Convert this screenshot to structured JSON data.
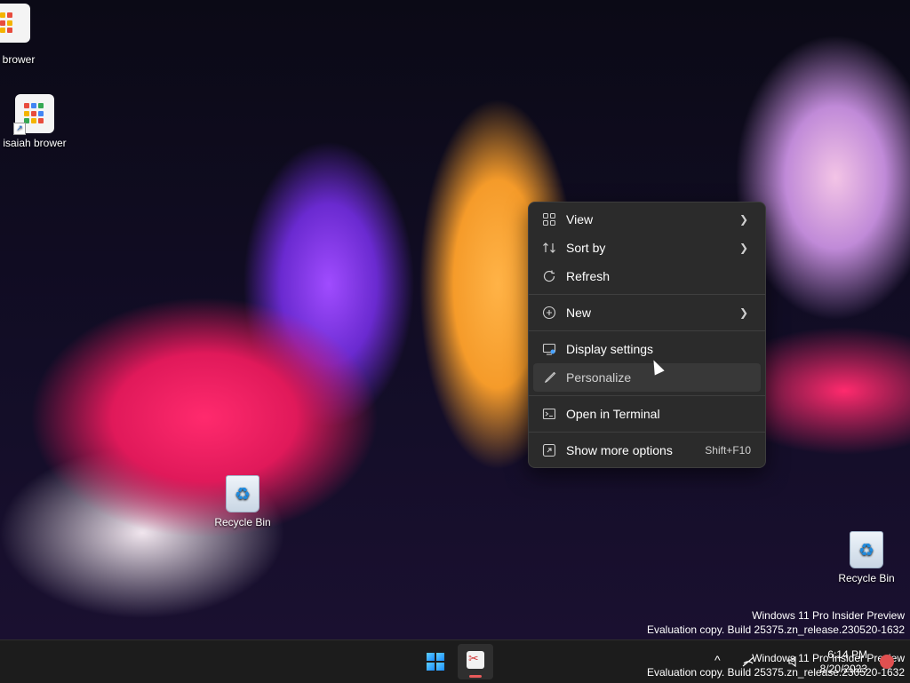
{
  "desktop": {
    "icons": [
      {
        "label": "isaiah brower",
        "kind": "app-shortcut"
      },
      {
        "label": "isaiah brower",
        "kind": "app-shortcut"
      },
      {
        "label": "Recycle Bin",
        "kind": "recycle-bin"
      },
      {
        "label": "Recycle Bin",
        "kind": "recycle-bin"
      }
    ],
    "top_icon_partial_label": "brower"
  },
  "context_menu": {
    "items": [
      {
        "label": "View",
        "icon": "view-grid-icon",
        "submenu": true
      },
      {
        "label": "Sort by",
        "icon": "sort-icon",
        "submenu": true
      },
      {
        "label": "Refresh",
        "icon": "refresh-icon",
        "submenu": false
      },
      {
        "label": "New",
        "icon": "add-circle-icon",
        "submenu": true
      },
      {
        "label": "Display settings",
        "icon": "display-settings-icon",
        "submenu": false
      },
      {
        "label": "Personalize",
        "icon": "brush-icon",
        "submenu": false,
        "hovered": true
      },
      {
        "label": "Open in Terminal",
        "icon": "terminal-icon",
        "submenu": false
      },
      {
        "label": "Show more options",
        "icon": "more-options-icon",
        "shortcut": "Shift+F10"
      }
    ]
  },
  "watermark": {
    "line1": "Windows 11 Pro Insider Preview",
    "line2": "Evaluation copy. Build 25375.zn_release.230520-1632"
  },
  "taskbar": {
    "clock_time": "6:14 PM",
    "clock_date": "8/20/2023",
    "overflow_chevron": "^",
    "watermark_overlay_line1": "Windows 11 Pro Insider Preview",
    "watermark_overlay_line2": "Evaluation copy. Build 25375.zn_release.230520-1632"
  },
  "colors": {
    "menu_bg": "#2b2b2b",
    "menu_hover": "#383838",
    "taskbar_bg": "#1c1c1c",
    "accent": "#1a8cff"
  }
}
